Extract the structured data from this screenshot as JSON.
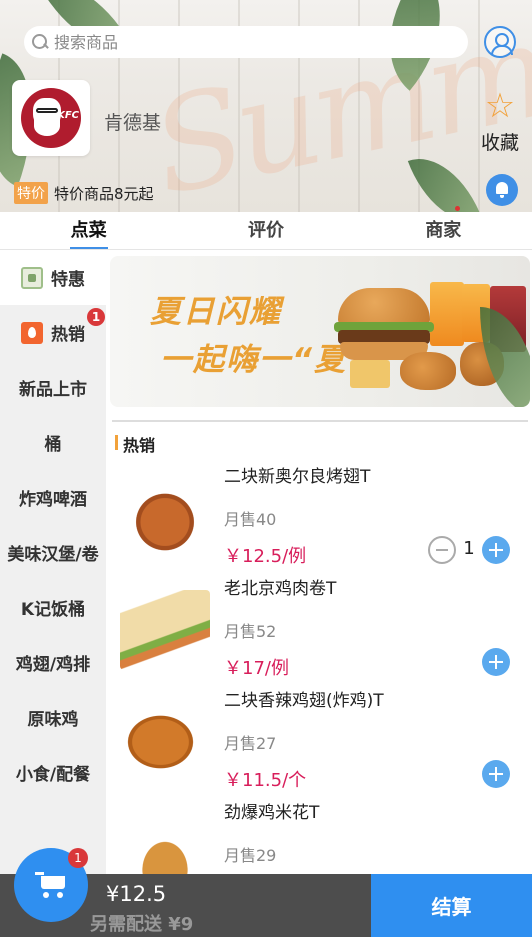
{
  "header": {
    "search_placeholder": "搜索商品",
    "store_name": "肯德基",
    "logo_text": "KFC",
    "favorite_label": "收藏",
    "promo_tag": "特价",
    "promo_text": "特价商品8元起"
  },
  "tabs": [
    {
      "label": "点菜",
      "active": true
    },
    {
      "label": "评价",
      "active": false
    },
    {
      "label": "商家",
      "active": false
    }
  ],
  "sidebar": {
    "items": [
      {
        "label": "特惠",
        "icon": "discount-icon",
        "active": true
      },
      {
        "label": "热销",
        "icon": "fire-icon",
        "badge": "1"
      },
      {
        "label": "新品上市"
      },
      {
        "label": "桶"
      },
      {
        "label": "炸鸡啤酒"
      },
      {
        "label": "美味汉堡/卷"
      },
      {
        "label": "K记饭桶"
      },
      {
        "label": "鸡翅/鸡排"
      },
      {
        "label": "原味鸡"
      },
      {
        "label": "小食/配餐"
      }
    ]
  },
  "banner": {
    "line1": "夏日闪耀",
    "line2": "一起嗨一“夏”"
  },
  "section": {
    "title": "热销"
  },
  "products": [
    {
      "name": "二块新奥尔良烤翅T",
      "sales": "月售40",
      "price": "￥12.5/例",
      "quantity": "1"
    },
    {
      "name": "老北京鸡肉卷T",
      "sales": "月售52",
      "price": "￥17/例"
    },
    {
      "name": "二块香辣鸡翅(炸鸡)T",
      "sales": "月售27",
      "price": "￥11.5/个"
    },
    {
      "name": "劲爆鸡米花T",
      "sales": "月售29"
    }
  ],
  "cart": {
    "badge": "1",
    "total": "¥12.5",
    "delivery_note": "另需配送 ¥9",
    "checkout_label": "结算"
  },
  "colors": {
    "accent": "#2f8ff0",
    "price": "#d81e5b",
    "badge": "#d9383a",
    "favorite": "#f2a23b"
  }
}
